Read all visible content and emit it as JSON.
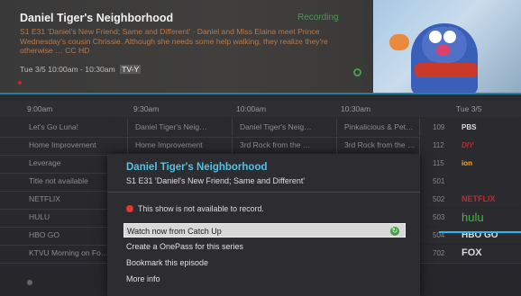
{
  "info": {
    "title": "Daniel Tiger's Neighborhood",
    "badge": "Recording",
    "desc": "S1 E31 'Daniel's New Friend; Same and Different' · Daniel and Miss Elaina meet Prince Wednesday's cousin Chrissie. Although she needs some help walking, they realize they're otherwise … CC HD",
    "meta": "Tue 3/5 10:00am - 10:30am",
    "rating": "TV-Y",
    "sub": ""
  },
  "guide": {
    "times": [
      "9:00am",
      "9:30am",
      "10:00am",
      "10:30am"
    ],
    "channel_header": "Tue 3/5",
    "rows": [
      {
        "cells": [
          "Let's Go Luna!",
          "Daniel Tiger's Neig…",
          "Daniel Tiger's Neig…",
          "Pinkalicious & Pet…"
        ],
        "num": "109",
        "logo": "PBS"
      },
      {
        "cells": [
          "Home Improvement",
          "Home Improvement",
          "3rd Rock from the …",
          "3rd Rock from the …"
        ],
        "num": "112",
        "logo": "DIY"
      },
      {
        "cells": [
          "Leverage",
          "",
          "",
          ""
        ],
        "num": "115",
        "logo": "ion"
      },
      {
        "cells": [
          "Title not available",
          "",
          "",
          ""
        ],
        "num": "501",
        "logo": ""
      },
      {
        "cells": [
          "NETFLIX",
          "",
          "",
          ""
        ],
        "num": "502",
        "logo": "NETFLIX"
      },
      {
        "cells": [
          "HULU",
          "",
          "",
          ""
        ],
        "num": "503",
        "logo": "hulu"
      },
      {
        "cells": [
          "HBO GO",
          "",
          "",
          ""
        ],
        "num": "504",
        "logo": "HBO GO"
      },
      {
        "cells": [
          "KTVU Morning on Fo…",
          "",
          "",
          ""
        ],
        "num": "702",
        "logo": "FOX"
      }
    ]
  },
  "modal": {
    "title": "Daniel Tiger's Neighborhood",
    "subtitle": "S1 E31 'Daniel's New Friend; Same and Different'",
    "warning": "This show is not available to record.",
    "options": [
      "Watch now from Catch Up",
      "Create a OnePass for this series",
      "Bookmark this episode",
      "More info"
    ],
    "selected_go": "↻"
  },
  "colors": {
    "accent": "#4fc3e8",
    "green": "#43a047",
    "warning": "#e53935",
    "netflix": "#c62828",
    "hulu": "#3dbb3d",
    "diy": "#c62828",
    "ion": "#f5a623"
  }
}
